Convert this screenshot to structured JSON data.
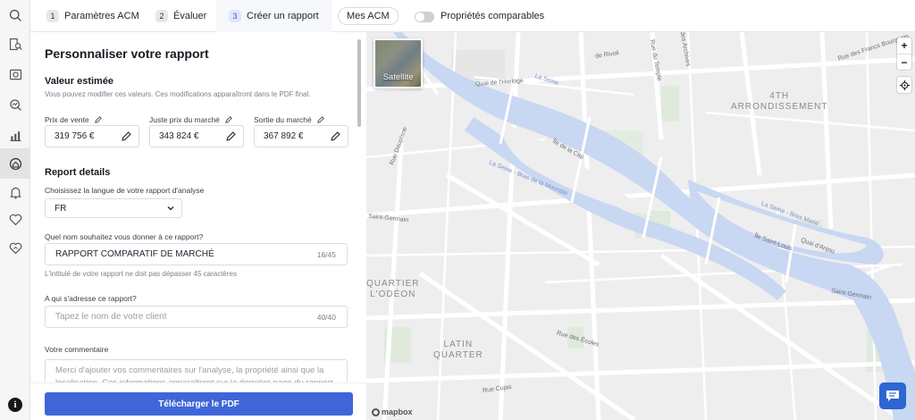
{
  "steps": [
    {
      "num": "1",
      "label": "Paramètres ACM"
    },
    {
      "num": "2",
      "label": "Évaluer"
    },
    {
      "num": "3",
      "label": "Créer un rapport"
    }
  ],
  "my_acm_label": "Mes ACM",
  "comparable_toggle_label": "Propriétés comparables",
  "panel": {
    "title": "Personnaliser votre rapport",
    "estimate": {
      "heading": "Valeur estimée",
      "hint": "Vous pouvez modifier ces valeurs. Ces modifications apparaîtront dans le PDF final.",
      "sale_price_label": "Prix de vente",
      "sale_price_value": "319 756 €",
      "fair_price_label": "Juste prix du marché",
      "fair_price_value": "343 824 €",
      "exit_price_label": "Sortie du marché",
      "exit_price_value": "367 892 €"
    },
    "details": {
      "heading": "Report details",
      "language_label": "Choisissez la langue de votre rapport d'analyse",
      "language_value": "FR",
      "name_label": "Quel nom souhaitez vous donner à ce rapport?",
      "name_value": "RAPPORT COMPARATIF  DE MARCHÉ",
      "name_count": "16/45",
      "name_hint": "L'intitulé de votre rapport ne doit pas dépasser 45 caractères",
      "recipient_label": "A qui s'adresse ce rapport?",
      "recipient_placeholder": "Tapez le nom de votre client",
      "recipient_count": "40/40",
      "comment_label": "Votre commentaire",
      "comment_placeholder": "Merci d'ajouter vos commentaires sur l'analyse, la propriété ainsi que la localisation. Ces informations apparaîtront sur la dernière page du rapport."
    },
    "download_label": "Télécharger le PDF"
  },
  "map": {
    "satellite_label": "Satellite",
    "zoom_in": "+",
    "zoom_out": "−",
    "attribution": "mapbox",
    "labels": {
      "arr4": "4TH\nARRONDISSEMENT",
      "odeon": "QUARTIER\nL'ODÉON",
      "latin": "LATIN\nQUARTER",
      "seine1": "La Seine",
      "seine2": "La Seine - Bras de la Monnaie",
      "seine3": "La Seine - Bras Marie",
      "ile_cite": "Île de la Cité",
      "ile_stlouis": "Île Saint-Louis",
      "quai_horloge": "Quai de l'Horloge",
      "quai_anjou": "Quai d'Anjou",
      "rue_dauphine": "Rue Dauphine",
      "st_germain": "Saint-Germain",
      "st_germain2": "Saint-Germain",
      "rue_ecoles": "Rue des Écoles",
      "rue_cujas": "Rue Cujas",
      "rue_rivoli": "de Rivoli",
      "rue_fb": "Rue des Francs Bourgeois",
      "rue_archives": "Rue des Archives",
      "rue_temple": "Rue du Temple"
    }
  }
}
